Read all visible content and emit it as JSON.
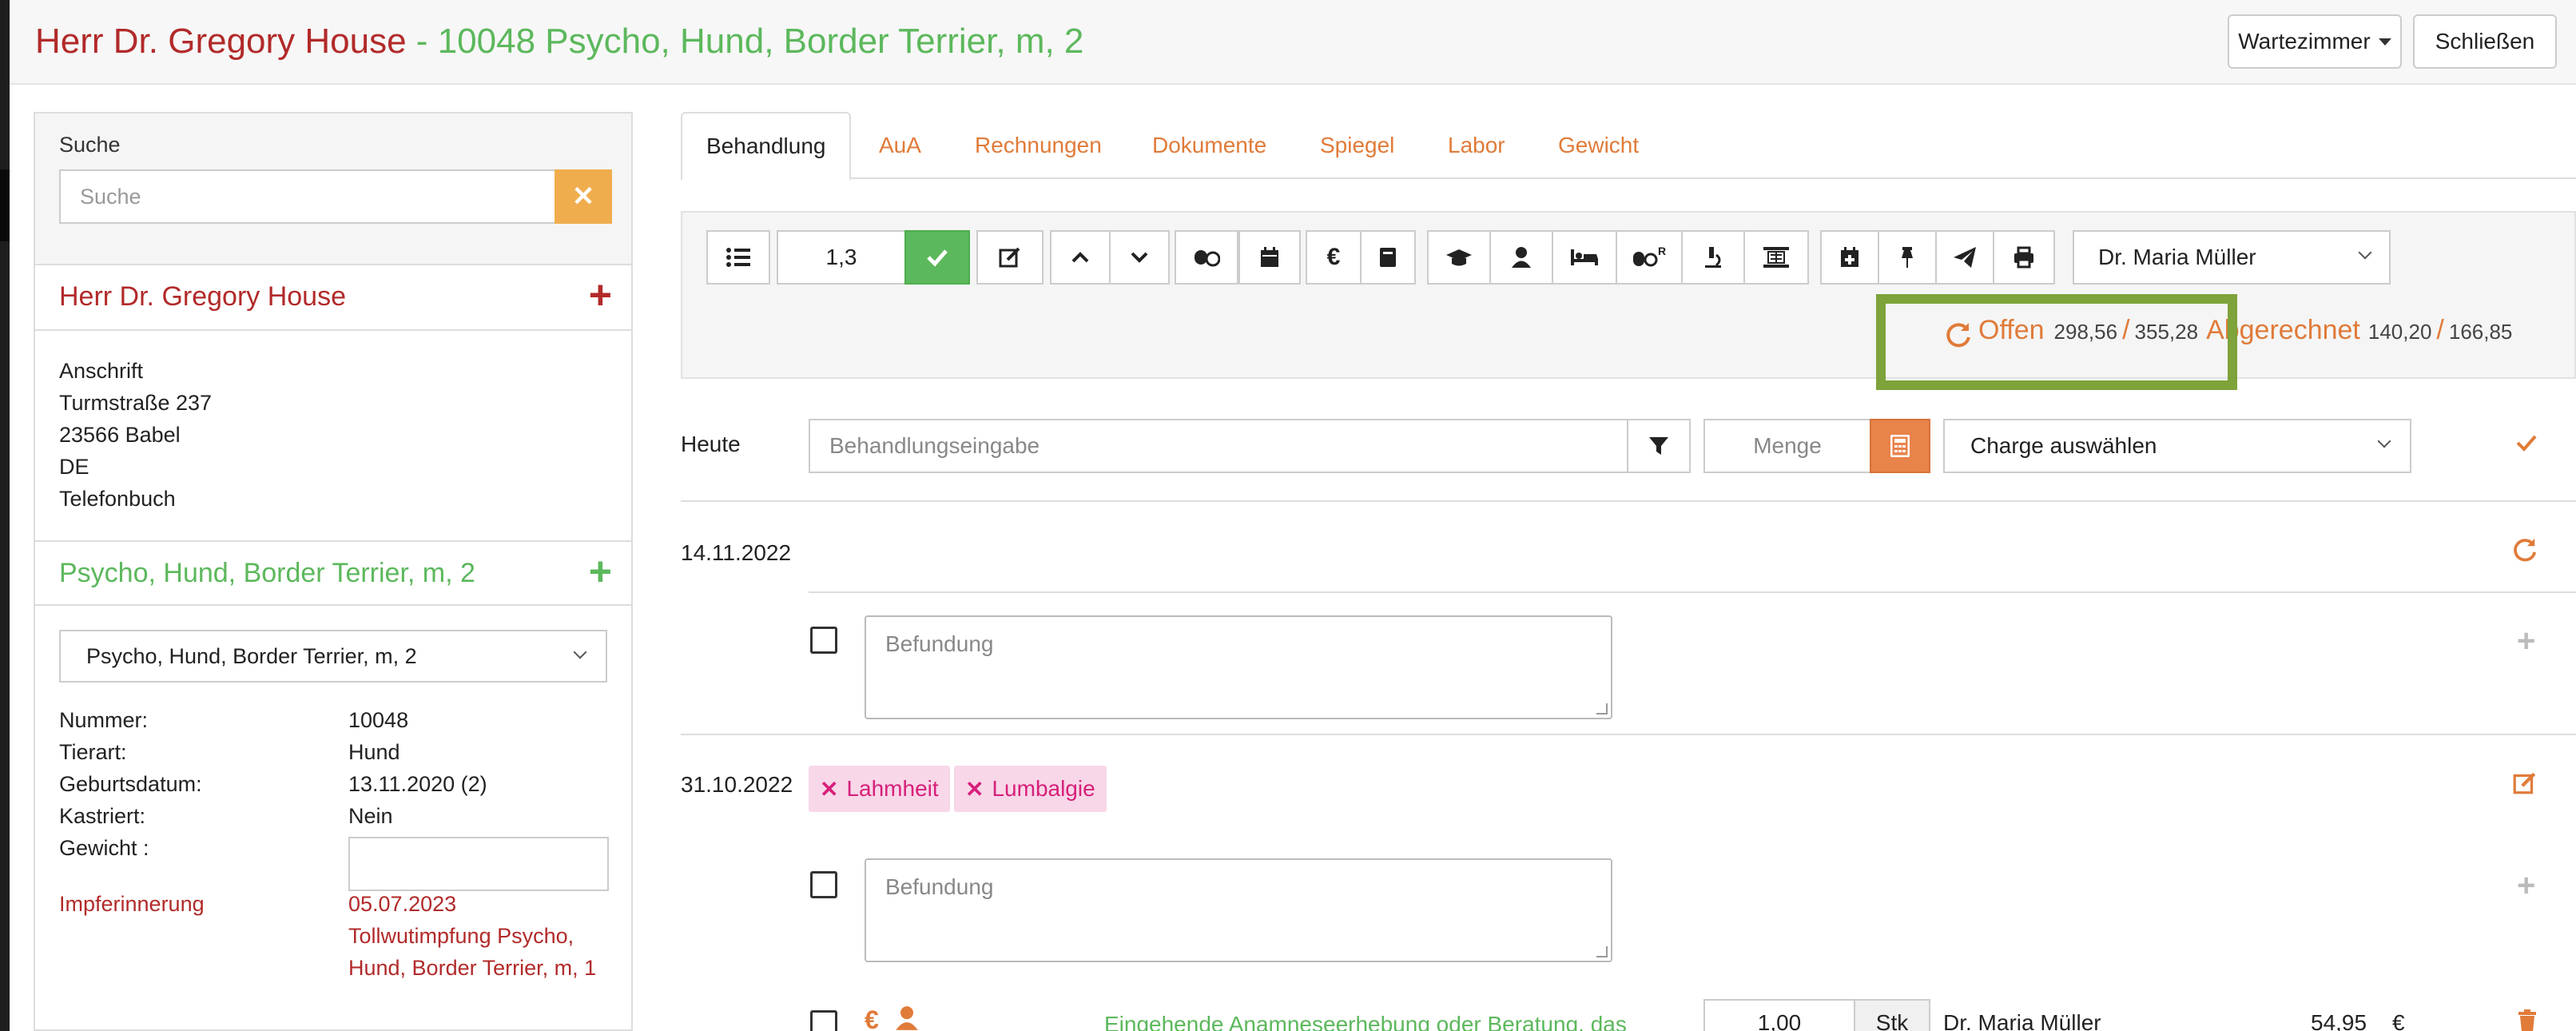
{
  "header": {
    "owner": "Herr Dr. Gregory House",
    "separator": " - ",
    "patient": "10048 Psycho, Hund, Border Terrier, m, 2",
    "waiting_room_label": "Wartezimmer",
    "close_label": "Schließen"
  },
  "sidebar": {
    "search_label": "Suche",
    "search_placeholder": "Suche",
    "search_clear": "✕",
    "owner_name": "Herr Dr. Gregory House",
    "address": {
      "heading": "Anschrift",
      "street": "Turmstraße 237",
      "city": "23566  Babel",
      "country": "DE",
      "phonebook": "Telefonbuch"
    },
    "pet_name": "Psycho, Hund, Border Terrier, m, 2",
    "pet_select_value": "Psycho, Hund, Border Terrier, m, 2",
    "details": [
      {
        "key": "Nummer:",
        "value": "10048"
      },
      {
        "key": "Tierart:",
        "value": "Hund"
      },
      {
        "key": "Geburtsdatum:",
        "value": "13.11.2020  (2)"
      },
      {
        "key": "Kastriert:",
        "value": "Nein"
      },
      {
        "key": "Gewicht :",
        "value": ""
      }
    ],
    "reminder_label": "Impferinnerung",
    "reminder_date": "05.07.2023",
    "reminder_text_1": "Tollwutimpfung Psycho,",
    "reminder_text_2": "Hund, Border Terrier, m, 1"
  },
  "tabs": [
    {
      "label": "Behandlung",
      "active": true
    },
    {
      "label": "AuA"
    },
    {
      "label": "Rechnungen"
    },
    {
      "label": "Dokumente"
    },
    {
      "label": "Spiegel"
    },
    {
      "label": "Labor"
    },
    {
      "label": "Gewicht"
    }
  ],
  "toolbar": {
    "factor_value": "1,3",
    "doctor_select": "Dr. Maria Müller",
    "icons": [
      "list-icon",
      "check-icon",
      "edit-icon",
      "chevron-up-icon",
      "chevron-down-icon",
      "pills-icon",
      "calendar-icon",
      "euro-icon",
      "book-icon",
      "graduation-cap-icon",
      "person-icon",
      "bed-icon",
      "pills-r-icon",
      "microscope-icon",
      "xray-icon",
      "calendar-plus-icon",
      "thumbtack-icon",
      "paper-plane-icon",
      "print-icon"
    ]
  },
  "status": {
    "open_label": "Offen",
    "open_value_1": "298,56",
    "slash": "/",
    "open_value_2": "355,28",
    "billed_label": "Abgerechnet",
    "billed_value_1": "140,20",
    "billed_value_2": "166,85"
  },
  "entry": {
    "today_label": "Heute",
    "treatment_placeholder": "Behandlungseingabe",
    "quantity_placeholder": "Menge",
    "charge_select": "Charge auswählen"
  },
  "history": [
    {
      "date": "14.11.2022",
      "finding_placeholder": "Befundung"
    },
    {
      "date": "31.10.2022",
      "finding_placeholder": "Befundung",
      "tags": [
        "Lahmheit",
        "Lumbalgie"
      ]
    }
  ],
  "line_item": {
    "description": "Eingehende Anamneseerhebung oder Beratung, das",
    "quantity": "1,00",
    "unit": "Stk",
    "doctor": "Dr. Maria Müller",
    "price": "54,95",
    "currency": "€"
  },
  "colors": {
    "owner_red": "#b22a2a",
    "pet_green": "#5cb85c",
    "accent_orange": "#e07b39",
    "highlight_green": "#7ea33a",
    "tag_pink": "#d6207a"
  }
}
